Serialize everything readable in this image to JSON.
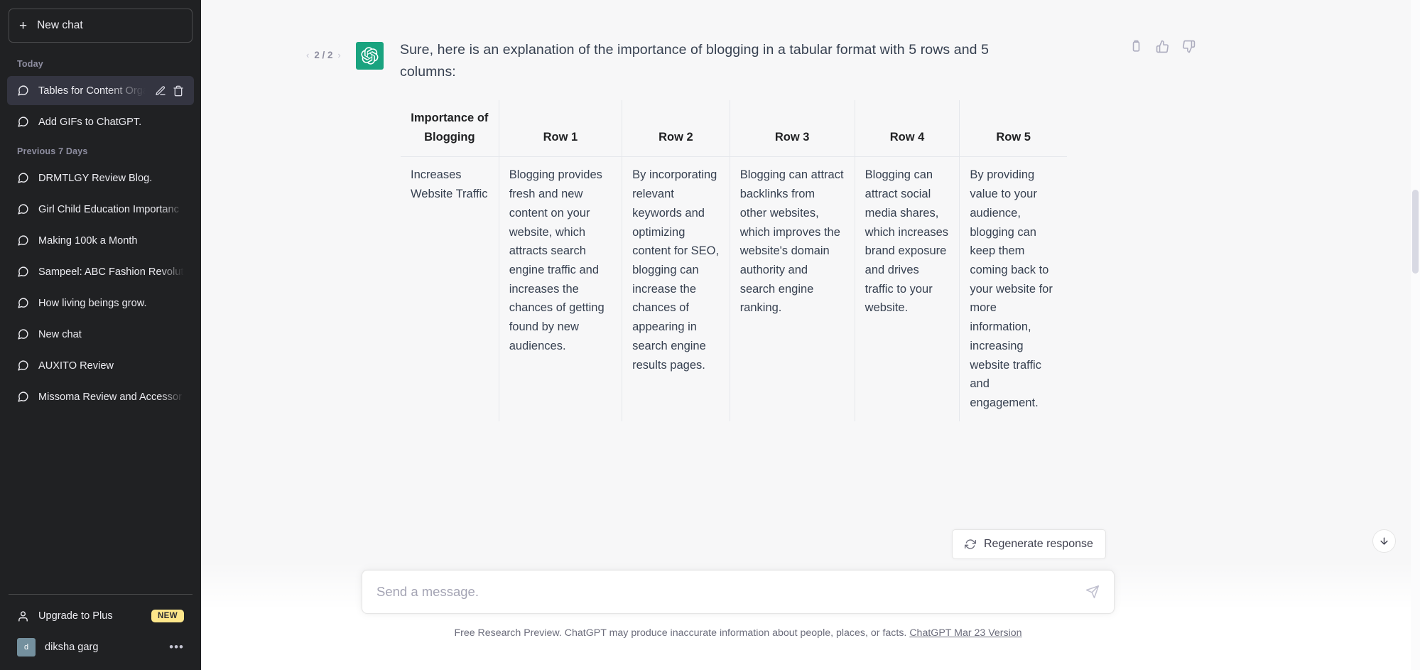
{
  "sidebar": {
    "new_chat_label": "New chat",
    "new_chat_icon": "plus-icon",
    "sections": [
      {
        "label": "Today"
      },
      {
        "label": "Previous 7 Days"
      }
    ],
    "today_items": [
      {
        "title": "Tables for Content Orga",
        "icon": "chat-bubble-icon",
        "active": true,
        "edit_icon": "pencil-icon",
        "delete_icon": "trash-icon"
      },
      {
        "title": "Add GIFs to ChatGPT.",
        "icon": "chat-bubble-icon",
        "active": false
      }
    ],
    "previous_items": [
      {
        "title": "DRMTLGY Review Blog.",
        "icon": "chat-bubble-icon"
      },
      {
        "title": "Girl Child Education Importanc",
        "icon": "chat-bubble-icon"
      },
      {
        "title": "Making 100k a Month",
        "icon": "chat-bubble-icon"
      },
      {
        "title": "Sampeel: ABC Fashion Revolut",
        "icon": "chat-bubble-icon"
      },
      {
        "title": "How living beings grow.",
        "icon": "chat-bubble-icon"
      },
      {
        "title": "New chat",
        "icon": "chat-bubble-icon"
      },
      {
        "title": "AUXITO Review",
        "icon": "chat-bubble-icon"
      },
      {
        "title": "Missoma Review and Accessor",
        "icon": "chat-bubble-icon"
      }
    ],
    "upgrade": {
      "label": "Upgrade to Plus",
      "badge": "NEW",
      "icon": "person-icon"
    },
    "user": {
      "name": "diksha garg",
      "avatar_initial": "d",
      "menu_icon": "ellipsis-icon"
    }
  },
  "message": {
    "pager": {
      "prev_icon": "chevron-left-icon",
      "count": "2 / 2",
      "next_icon": "chevron-right-icon"
    },
    "avatar_icon": "chatgpt-logo-icon",
    "text": "Sure, here is an explanation of the importance of blogging in a tabular format with 5 rows and 5 columns:",
    "actions": [
      {
        "name": "copy-icon"
      },
      {
        "name": "thumbs-up-icon"
      },
      {
        "name": "thumbs-down-icon"
      }
    ]
  },
  "table": {
    "headers": [
      "Importance of Blogging",
      "Row 1",
      "Row 2",
      "Row 3",
      "Row 4",
      "Row 5"
    ],
    "rows": [
      [
        "Increases Website Traffic",
        "Blogging provides fresh and new content on your website, which attracts search engine traffic and increases the chances of getting found by new audiences.",
        "By incorporating relevant keywords and optimizing content for SEO, blogging can increase the chances of appearing in search engine results pages.",
        "Blogging can attract backlinks from other websites, which improves the website's domain authority and search engine ranking.",
        "Blogging can attract social media shares, which increases brand exposure and drives traffic to your website.",
        "By providing value to your audience, blogging can keep them coming back to your website for more information, increasing website traffic and engagement."
      ]
    ]
  },
  "regenerate": {
    "label": "Regenerate response",
    "icon": "refresh-icon"
  },
  "scroll_button": {
    "icon": "arrow-down-icon"
  },
  "composer": {
    "placeholder": "Send a message.",
    "value": "",
    "send_icon": "send-plane-icon"
  },
  "footer": {
    "text": "Free Research Preview. ChatGPT may produce inaccurate information about people, places, or facts.",
    "link": "ChatGPT Mar 23 Version"
  },
  "colors": {
    "sidebar_bg": "#202123",
    "sidebar_active": "#343541",
    "main_bg": "#F7F7F8",
    "accent_green": "#19A37F",
    "badge_new": "#FDE68A",
    "text_light": "#ECECF1",
    "text_muted": "#8E8EA0",
    "body_text": "#374151",
    "border": "#E5E7EB"
  }
}
